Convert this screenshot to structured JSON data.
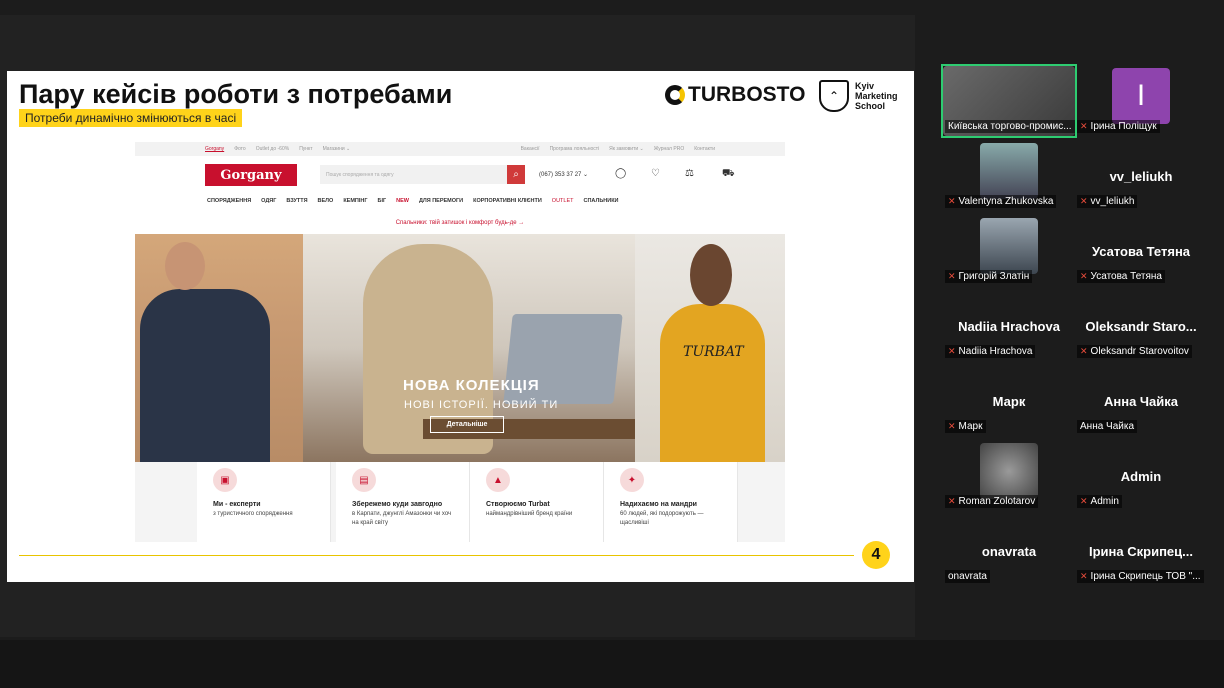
{
  "slide": {
    "title": "Пару кейсів роботи з потребами",
    "subtitle": "Потреби динамічно змінюються в часі",
    "turbosto": "TURBOSTO",
    "kms_line1": "Kyiv",
    "kms_line2": "Marketing",
    "kms_line3": "School",
    "page_number": "4",
    "site": {
      "topnav": [
        "Gorgany",
        "Фото",
        "Outlet до -60%",
        "Пункт",
        "Магазини ⌄"
      ],
      "topnav_right": [
        "Вакансії",
        "Програма лояльності",
        "Як замовити ⌄",
        "Журнал PRO",
        "Контакти"
      ],
      "logo": "Gorgany",
      "search_placeholder": "Пошук спорядження та одягу",
      "phone": "(067) 353 37 27 ⌄",
      "categories": [
        "СПОРЯДЖЕННЯ",
        "ОДЯГ",
        "ВЗУТТЯ",
        "ВЕЛО",
        "КЕМПІНГ",
        "БІГ",
        "NEW",
        "ДЛЯ ПЕРЕМОГИ",
        "КОРПОРАТИВНІ КЛІЄНТИ",
        "OUTLET",
        "СПАЛЬНИКИ"
      ],
      "promo": "Спальники: твій затишок і комфорт будь-де →",
      "hero_title": "НОВА КОЛЕКЦІЯ",
      "hero_subtitle": "НОВІ ІСТОРІЇ. НОВИЙ ТИ",
      "hero_button": "Детальніше",
      "hero_brand": "TURBAT",
      "features": [
        {
          "title": "Ми - експерти",
          "desc": "з туристичного спорядження"
        },
        {
          "title": "Збережемо куди завгодно",
          "desc": "в Карпати, джунглі Амазонки чи хоч на край світу"
        },
        {
          "title": "Створюємо Turbat",
          "desc": "наймандрівніший бренд країни"
        },
        {
          "title": "Надихаємо на мандри",
          "desc": "60 людей, які подорожують — щасливіші"
        }
      ]
    }
  },
  "participants": [
    {
      "display": "",
      "label": "Київська торгово-промис...",
      "muted": false
    },
    {
      "display": "I",
      "label": "Ірина Поліщук",
      "muted": true
    },
    {
      "display": "",
      "label": "Valentyna Zhukovska",
      "muted": true
    },
    {
      "display": "vv_leliukh",
      "label": "vv_leliukh",
      "muted": true
    },
    {
      "display": "",
      "label": "Григорій Златін",
      "muted": true
    },
    {
      "display": "Усатова Тетяна",
      "label": "Усатова Тетяна",
      "muted": true
    },
    {
      "display": "Nadiia Hrachova",
      "label": "Nadiia Hrachova",
      "muted": true
    },
    {
      "display": "Oleksandr Staro...",
      "label": "Oleksandr Starovoitov",
      "muted": true
    },
    {
      "display": "Марк",
      "label": "Марк",
      "muted": true
    },
    {
      "display": "Анна Чайка",
      "label": "Анна Чайка",
      "muted": false
    },
    {
      "display": "",
      "label": "Roman Zolotarov",
      "muted": true
    },
    {
      "display": "Admin",
      "label": "Admin",
      "muted": true
    },
    {
      "display": "onavrata",
      "label": "onavrata",
      "muted": false
    },
    {
      "display": "Ірина Скрипец...",
      "label": "Ірина Скрипець ТОВ \"...",
      "muted": true
    }
  ],
  "colors": {
    "accent": "#ffd31a",
    "brand_red": "#c8102e",
    "active_border": "#2ecc71"
  }
}
